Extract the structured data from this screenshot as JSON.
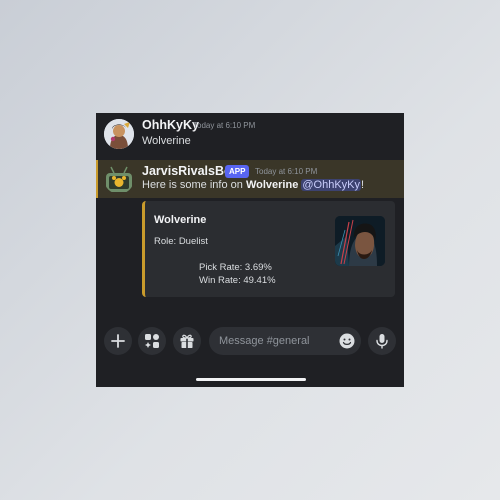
{
  "messages": [
    {
      "username": "OhhKyKy",
      "timestamp": "Today at 6:10 PM",
      "text": "Wolverine"
    },
    {
      "username": "JarvisRivalsBot",
      "badge": "APP",
      "timestamp": "Today at 6:10 PM",
      "text_prefix": "Here is some info on ",
      "text_bold": "Wolverine",
      "mention": "@OhhKyKy",
      "text_suffix": "!"
    }
  ],
  "embed": {
    "title": "Wolverine",
    "role": "Role: Duelist",
    "pick_rate": "Pick Rate: 3.69%",
    "win_rate": "Win Rate: 49.41%",
    "accent_color": "#c99b2c"
  },
  "composer": {
    "placeholder": "Message #general",
    "buttons": [
      "plus-icon",
      "apps-icon",
      "gift-icon"
    ],
    "emoji_icon": "emoji-icon",
    "mic_icon": "microphone-icon"
  },
  "colors": {
    "background": "#1f2024",
    "highlight_row": "#3a3628",
    "app_badge": "#5865f2",
    "mention_bg": "#3c4270"
  }
}
